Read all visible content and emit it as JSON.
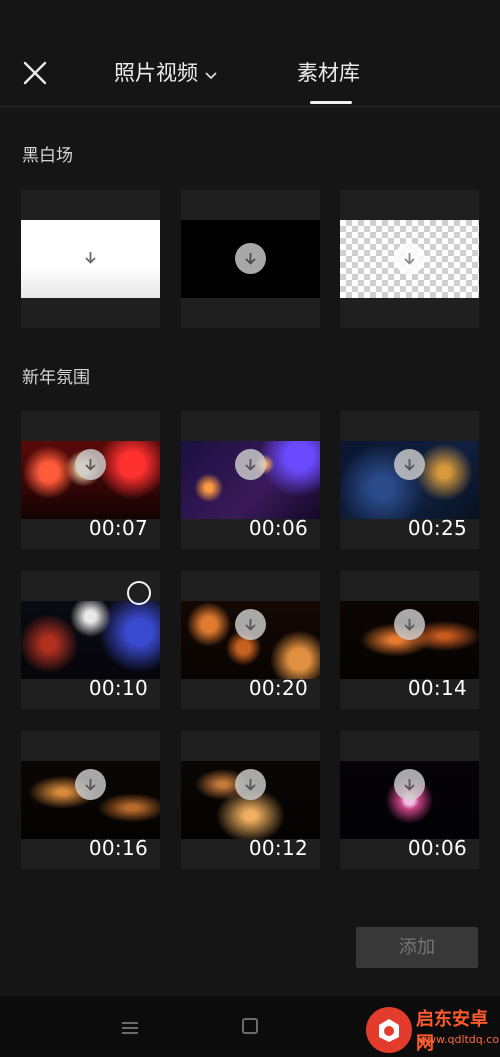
{
  "header": {
    "close_icon": "close-icon",
    "tabs": [
      {
        "label": "照片视频",
        "has_dropdown": true
      },
      {
        "label": "素材库",
        "active": true
      }
    ]
  },
  "sections": [
    {
      "title": "黑白场",
      "items": [
        {
          "name": "white",
          "download_icon": "download-icon"
        },
        {
          "name": "black",
          "download_icon": "download-icon"
        },
        {
          "name": "transparent",
          "download_icon": "download-icon"
        }
      ]
    },
    {
      "title": "新年氛围",
      "items": [
        {
          "duration": "00:07",
          "download_icon": "download-icon"
        },
        {
          "duration": "00:06",
          "download_icon": "download-icon"
        },
        {
          "duration": "00:25",
          "download_icon": "download-icon"
        },
        {
          "duration": "00:10",
          "select_icon": "select-circle-icon"
        },
        {
          "duration": "00:20",
          "download_icon": "download-icon"
        },
        {
          "duration": "00:14",
          "download_icon": "download-icon"
        },
        {
          "duration": "00:16",
          "download_icon": "download-icon"
        },
        {
          "duration": "00:12",
          "download_icon": "download-icon"
        },
        {
          "duration": "00:06",
          "download_icon": "download-icon"
        }
      ]
    }
  ],
  "add_button": {
    "label": "添加",
    "enabled": false
  },
  "navbar": {
    "icons": [
      "menu-icon",
      "home-icon"
    ]
  },
  "watermark": {
    "name": "启东安卓网",
    "url": "www.qdltdq.com"
  },
  "colors": {
    "background": "#151515",
    "card": "#1f1f1f",
    "accent_text": "#ffffff",
    "disabled_button": "#383838"
  }
}
